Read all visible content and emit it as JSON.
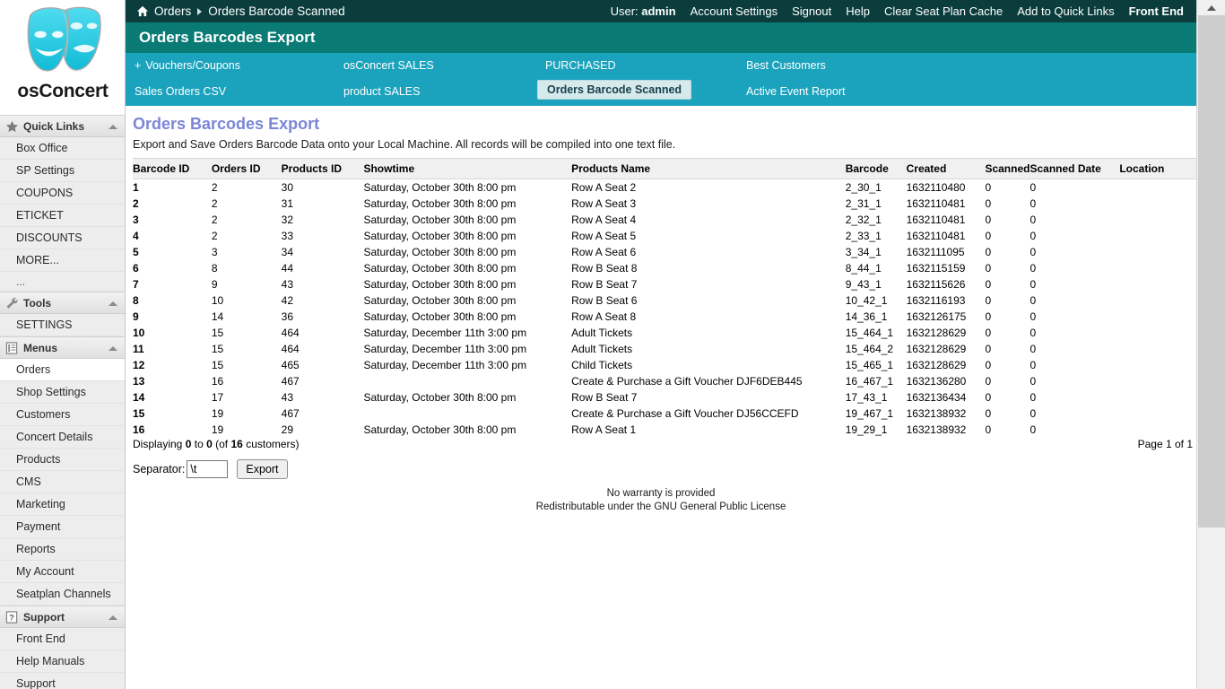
{
  "brand": {
    "name": "osConcert",
    "logo_icon": "theatre-masks-icon"
  },
  "topbar": {
    "home_icon": "home-icon",
    "breadcrumb": [
      "Orders",
      "Orders Barcode Scanned"
    ],
    "user_prefix": "User:",
    "user_name": "admin",
    "links": [
      "Account Settings",
      "Signout",
      "Help",
      "Clear Seat Plan Cache",
      "Add to Quick Links"
    ],
    "front_end": "Front End"
  },
  "title_band": {
    "title": "Orders Barcodes Export"
  },
  "nav": {
    "items": [
      {
        "label": "Vouchers/Coupons",
        "plus": "+",
        "selected": false
      },
      {
        "label": "osConcert SALES",
        "selected": false
      },
      {
        "label": "PURCHASED",
        "selected": false
      },
      {
        "label": "Best Customers",
        "selected": false
      },
      {
        "label": "Sales Orders CSV",
        "selected": false
      },
      {
        "label": "product SALES",
        "selected": false
      },
      {
        "label": "Orders Barcode Scanned",
        "selected": true
      },
      {
        "label": "Active Event Report",
        "selected": false
      }
    ]
  },
  "sidebar": {
    "groups": [
      {
        "label": "Quick Links",
        "icon": "star-icon",
        "caret": "caret-up-icon",
        "items": [
          {
            "label": "Box Office",
            "active": false
          },
          {
            "label": "SP Settings",
            "active": false
          },
          {
            "label": "COUPONS",
            "active": false
          },
          {
            "label": "ETICKET",
            "active": false
          },
          {
            "label": "DISCOUNTS",
            "active": false
          },
          {
            "label": "MORE...",
            "active": false
          },
          {
            "label": "...",
            "active": false,
            "tiny": true
          }
        ]
      },
      {
        "label": "Tools",
        "icon": "wrench-icon",
        "caret": "caret-up-icon",
        "items": [
          {
            "label": "SETTINGS",
            "active": false
          }
        ]
      },
      {
        "label": "Menus",
        "icon": "list-icon",
        "caret": "caret-up-icon",
        "items": [
          {
            "label": "Orders",
            "active": true
          },
          {
            "label": "Shop Settings",
            "active": false
          },
          {
            "label": "Customers",
            "active": false
          },
          {
            "label": "Concert Details",
            "active": false
          },
          {
            "label": "Products",
            "active": false
          },
          {
            "label": "CMS",
            "active": false
          },
          {
            "label": "Marketing",
            "active": false
          },
          {
            "label": "Payment",
            "active": false
          },
          {
            "label": "Reports",
            "active": false
          },
          {
            "label": "My Account",
            "active": false
          },
          {
            "label": "Seatplan Channels",
            "active": false
          }
        ]
      },
      {
        "label": "Support",
        "icon": "question-icon",
        "caret": "caret-up-icon",
        "items": [
          {
            "label": "Front End",
            "active": false
          },
          {
            "label": "Help Manuals",
            "active": false
          },
          {
            "label": "Support",
            "active": false
          }
        ]
      }
    ]
  },
  "page": {
    "heading": "Orders Barcodes Export",
    "description": "Export and Save Orders Barcode Data onto your Local Machine. All records will be compiled into one text file."
  },
  "table": {
    "columns": [
      "Barcode ID",
      "Orders ID",
      "Products ID",
      "Showtime",
      "Products Name",
      "Barcode",
      "Created",
      "Scanned",
      "Scanned Date",
      "Location"
    ],
    "rows": [
      [
        "1",
        "2",
        "30",
        "Saturday, October 30th 8:00 pm",
        "Row A Seat 2",
        "2_30_1",
        "1632110480",
        "0",
        "0",
        ""
      ],
      [
        "2",
        "2",
        "31",
        "Saturday, October 30th 8:00 pm",
        "Row A Seat 3",
        "2_31_1",
        "1632110481",
        "0",
        "0",
        ""
      ],
      [
        "3",
        "2",
        "32",
        "Saturday, October 30th 8:00 pm",
        "Row A Seat 4",
        "2_32_1",
        "1632110481",
        "0",
        "0",
        ""
      ],
      [
        "4",
        "2",
        "33",
        "Saturday, October 30th 8:00 pm",
        "Row A Seat 5",
        "2_33_1",
        "1632110481",
        "0",
        "0",
        ""
      ],
      [
        "5",
        "3",
        "34",
        "Saturday, October 30th 8:00 pm",
        "Row A Seat 6",
        "3_34_1",
        "1632111095",
        "0",
        "0",
        ""
      ],
      [
        "6",
        "8",
        "44",
        "Saturday, October 30th 8:00 pm",
        "Row B Seat 8",
        "8_44_1",
        "1632115159",
        "0",
        "0",
        ""
      ],
      [
        "7",
        "9",
        "43",
        "Saturday, October 30th 8:00 pm",
        "Row B Seat 7",
        "9_43_1",
        "1632115626",
        "0",
        "0",
        ""
      ],
      [
        "8",
        "10",
        "42",
        "Saturday, October 30th 8:00 pm",
        "Row B Seat 6",
        "10_42_1",
        "1632116193",
        "0",
        "0",
        ""
      ],
      [
        "9",
        "14",
        "36",
        "Saturday, October 30th 8:00 pm",
        "Row A Seat 8",
        "14_36_1",
        "1632126175",
        "0",
        "0",
        ""
      ],
      [
        "10",
        "15",
        "464",
        "Saturday, December 11th 3:00 pm",
        "Adult Tickets",
        "15_464_1",
        "1632128629",
        "0",
        "0",
        ""
      ],
      [
        "11",
        "15",
        "464",
        "Saturday, December 11th 3:00 pm",
        "Adult Tickets",
        "15_464_2",
        "1632128629",
        "0",
        "0",
        ""
      ],
      [
        "12",
        "15",
        "465",
        "Saturday, December 11th 3:00 pm",
        "Child Tickets",
        "15_465_1",
        "1632128629",
        "0",
        "0",
        ""
      ],
      [
        "13",
        "16",
        "467",
        "",
        "Create & Purchase a Gift Voucher DJF6DEB445",
        "16_467_1",
        "1632136280",
        "0",
        "0",
        ""
      ],
      [
        "14",
        "17",
        "43",
        "Saturday, October 30th 8:00 pm",
        "Row B Seat 7",
        "17_43_1",
        "1632136434",
        "0",
        "0",
        ""
      ],
      [
        "15",
        "19",
        "467",
        "",
        "Create & Purchase a Gift Voucher DJ56CCEFD",
        "19_467_1",
        "1632138932",
        "0",
        "0",
        ""
      ],
      [
        "16",
        "19",
        "29",
        "Saturday, October 30th 8:00 pm",
        "Row A Seat 1",
        "19_29_1",
        "1632138932",
        "0",
        "0",
        ""
      ]
    ]
  },
  "footer": {
    "displaying_prefix": "Displaying",
    "displaying_from": "0",
    "displaying_mid": "to",
    "displaying_to": "0",
    "displaying_of_open": "(of",
    "displaying_total": "16",
    "displaying_suffix": "customers)",
    "page_info": "Page 1 of 1"
  },
  "export": {
    "separator_label": "Separator:",
    "separator_value": "\\t",
    "button_label": "Export"
  },
  "licence": {
    "line1": "No warranty is provided",
    "line2": "Redistributable under the GNU General Public License"
  },
  "colors": {
    "topbar": "#0b3d3d",
    "title_band": "#0a7a74",
    "nav_band": "#1ba3bd",
    "heading": "#7b86d6",
    "nav_selected_bg": "#d6e9eb",
    "logo_cyan": "#2ad2e8"
  }
}
